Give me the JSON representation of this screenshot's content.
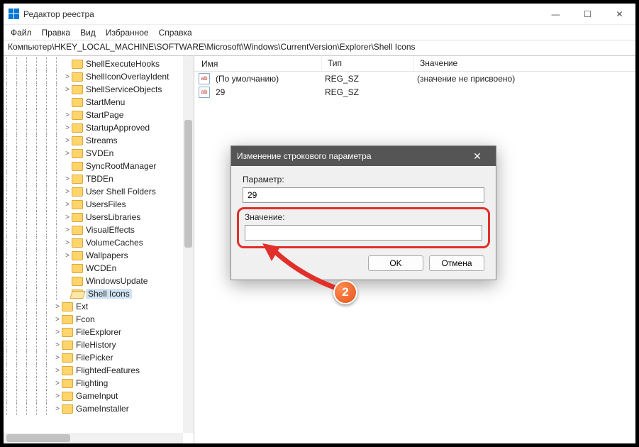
{
  "window": {
    "title": "Редактор реестра"
  },
  "menu": {
    "file": "Файл",
    "edit": "Правка",
    "view": "Вид",
    "favorites": "Избранное",
    "help": "Справка"
  },
  "address": "Компьютер\\HKEY_LOCAL_MACHINE\\SOFTWARE\\Microsoft\\Windows\\CurrentVersion\\Explorer\\Shell Icons",
  "tree": [
    {
      "label": "ShellExecuteHooks",
      "depth": 6,
      "arrow": "",
      "selected": false
    },
    {
      "label": "ShellIconOverlayIdent",
      "depth": 6,
      "arrow": ">",
      "selected": false
    },
    {
      "label": "ShellServiceObjects",
      "depth": 6,
      "arrow": ">",
      "selected": false
    },
    {
      "label": "StartMenu",
      "depth": 6,
      "arrow": "",
      "selected": false
    },
    {
      "label": "StartPage",
      "depth": 6,
      "arrow": ">",
      "selected": false
    },
    {
      "label": "StartupApproved",
      "depth": 6,
      "arrow": ">",
      "selected": false
    },
    {
      "label": "Streams",
      "depth": 6,
      "arrow": ">",
      "selected": false
    },
    {
      "label": "SVDEn",
      "depth": 6,
      "arrow": ">",
      "selected": false
    },
    {
      "label": "SyncRootManager",
      "depth": 6,
      "arrow": "",
      "selected": false
    },
    {
      "label": "TBDEn",
      "depth": 6,
      "arrow": ">",
      "selected": false
    },
    {
      "label": "User Shell Folders",
      "depth": 6,
      "arrow": ">",
      "selected": false
    },
    {
      "label": "UsersFiles",
      "depth": 6,
      "arrow": ">",
      "selected": false
    },
    {
      "label": "UsersLibraries",
      "depth": 6,
      "arrow": ">",
      "selected": false
    },
    {
      "label": "VisualEffects",
      "depth": 6,
      "arrow": ">",
      "selected": false
    },
    {
      "label": "VolumeCaches",
      "depth": 6,
      "arrow": ">",
      "selected": false
    },
    {
      "label": "Wallpapers",
      "depth": 6,
      "arrow": ">",
      "selected": false
    },
    {
      "label": "WCDEn",
      "depth": 6,
      "arrow": "",
      "selected": false
    },
    {
      "label": "WindowsUpdate",
      "depth": 6,
      "arrow": "",
      "selected": false
    },
    {
      "label": "Shell Icons",
      "depth": 6,
      "arrow": "",
      "selected": true,
      "open": true
    },
    {
      "label": "Ext",
      "depth": 5,
      "arrow": ">",
      "selected": false
    },
    {
      "label": "Fcon",
      "depth": 5,
      "arrow": ">",
      "selected": false
    },
    {
      "label": "FileExplorer",
      "depth": 5,
      "arrow": ">",
      "selected": false
    },
    {
      "label": "FileHistory",
      "depth": 5,
      "arrow": ">",
      "selected": false
    },
    {
      "label": "FilePicker",
      "depth": 5,
      "arrow": ">",
      "selected": false
    },
    {
      "label": "FlightedFeatures",
      "depth": 5,
      "arrow": ">",
      "selected": false
    },
    {
      "label": "Flighting",
      "depth": 5,
      "arrow": ">",
      "selected": false
    },
    {
      "label": "GameInput",
      "depth": 5,
      "arrow": ">",
      "selected": false
    },
    {
      "label": "GameInstaller",
      "depth": 5,
      "arrow": ">",
      "selected": false
    }
  ],
  "list": {
    "columns": {
      "name": "Имя",
      "type": "Тип",
      "value": "Значение"
    },
    "rows": [
      {
        "icon": "ab",
        "name": "(По умолчанию)",
        "type": "REG_SZ",
        "value": "(значение не присвоено)"
      },
      {
        "icon": "ab",
        "name": "29",
        "type": "REG_SZ",
        "value": ""
      }
    ]
  },
  "dialog": {
    "title": "Изменение строкового параметра",
    "param_label": "Параметр:",
    "param_value": "29",
    "value_label": "Значение:",
    "value_value": "",
    "ok": "OK",
    "cancel": "Отмена"
  },
  "annotation": {
    "number": "2"
  }
}
